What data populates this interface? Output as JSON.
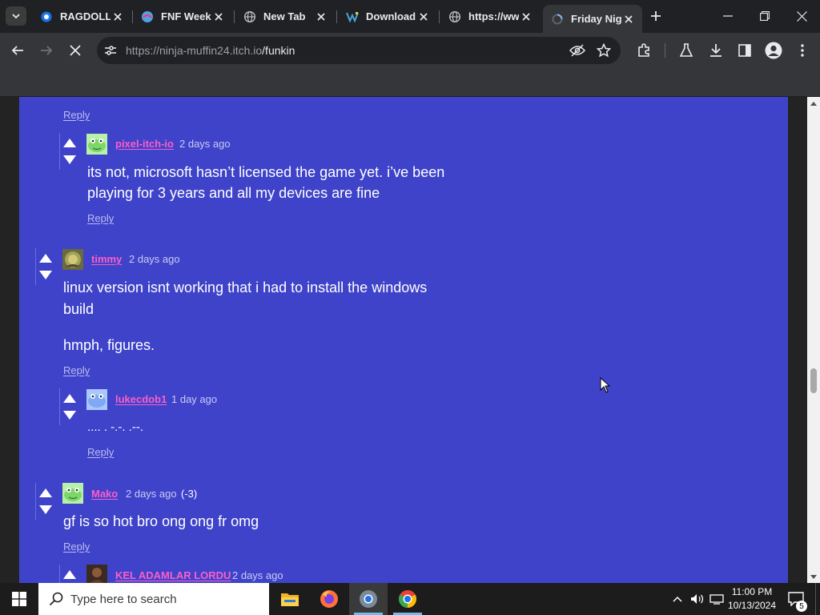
{
  "browser": {
    "tabs": [
      {
        "title": "RAGDOLL",
        "icon": "globe-blue-icon"
      },
      {
        "title": "FNF Week",
        "icon": "fnf-icon"
      },
      {
        "title": "New Tab",
        "icon": "globe-icon"
      },
      {
        "title": "Download",
        "icon": "download-site-icon"
      },
      {
        "title": "https://ww",
        "icon": "globe-icon"
      },
      {
        "title": "Friday Nig",
        "icon": "loading-icon",
        "active": true
      }
    ],
    "url_host": "https://ninja-muffin24.itch.io",
    "url_path": "/funkin"
  },
  "comments": [
    {
      "reply_label": "Reply"
    },
    {
      "username": "pixel-itch-io",
      "time": "2 days ago",
      "body": [
        "its not, microsoft hasn’t licensed the game yet. i’ve been",
        "playing for 3 years and all my devices are fine"
      ],
      "reply_label": "Reply"
    },
    {
      "username": "timmy",
      "time": "2 days ago",
      "body": [
        "linux version isnt working that i had to install the windows",
        "build"
      ],
      "body2": "hmph, figures.",
      "reply_label": "Reply"
    },
    {
      "username": "lukecdob1",
      "time": "1 day ago",
      "body": ".... . -.-. .--.",
      "reply_label": "Reply"
    },
    {
      "username": "Mako",
      "time": "2 days ago",
      "score": "(-3)",
      "body": "gf is so hot bro ong ong fr omg",
      "reply_label": "Reply"
    },
    {
      "username": "KEL ADAMLAR LORDU",
      "time": "2 days ago"
    }
  ],
  "taskbar": {
    "search_placeholder": "Type here to search",
    "time": "11:00 PM",
    "date": "10/13/2024",
    "notification_count": "5"
  },
  "colors": {
    "page_column": "#3f43c9",
    "username": "#ff5dc8"
  }
}
